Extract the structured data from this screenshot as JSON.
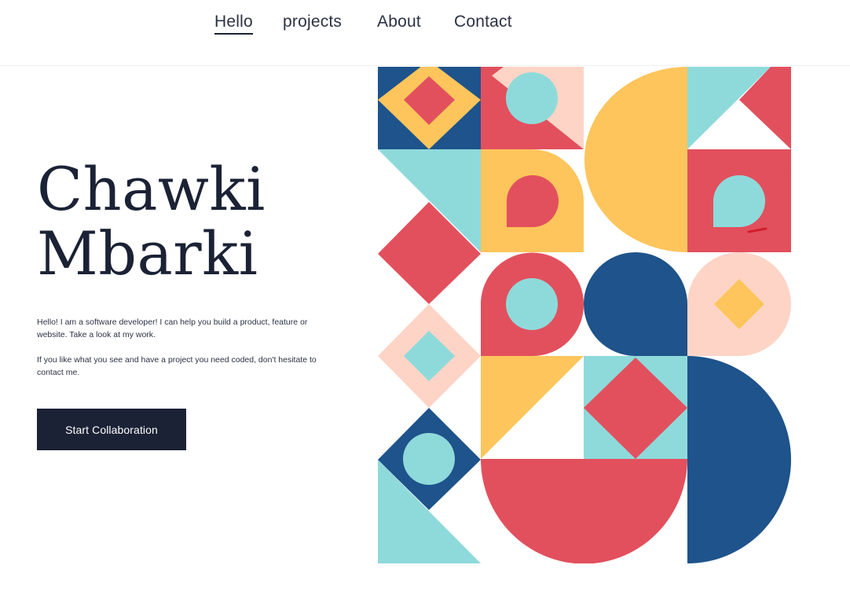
{
  "nav": {
    "items": [
      {
        "label": "Hello",
        "active": true
      },
      {
        "label": "projects",
        "active": false
      },
      {
        "label": "About",
        "active": false
      },
      {
        "label": "Contact",
        "active": false
      }
    ]
  },
  "hero": {
    "first_name": "Chawki",
    "last_name": "Mbarki",
    "intro_1": "Hello! I am a software developer! I can help you build a product, feature or website. Take a look at my work.",
    "intro_2": "If you like what you see and have a project you need coded, don't hesitate to contact me.",
    "cta_label": "Start Collaboration"
  },
  "art": {
    "colors": {
      "navy": "#1e538b",
      "red": "#e2505d",
      "yellow": "#fec55c",
      "teal": "#8edadb",
      "peach": "#fed4c6",
      "white": "#ffffff"
    }
  }
}
